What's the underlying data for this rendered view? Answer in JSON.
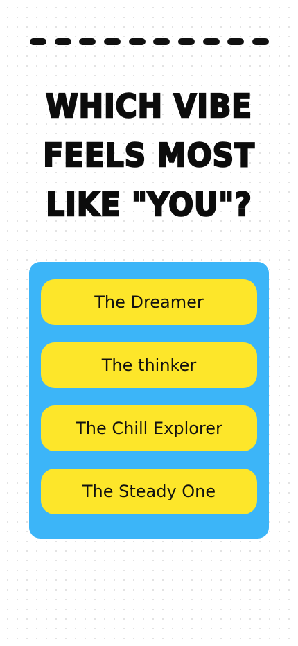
{
  "header": {
    "dash_count": 10,
    "title": "Which vibe feels most like \"you\"?"
  },
  "options": [
    {
      "label": "The Dreamer"
    },
    {
      "label": "The thinker"
    },
    {
      "label": "The Chill Explorer"
    },
    {
      "label": "The Steady One"
    }
  ],
  "colors": {
    "background": "#ffffff",
    "panel": "#3cb5f8",
    "option_button": "#fde62a",
    "text": "#111111"
  }
}
